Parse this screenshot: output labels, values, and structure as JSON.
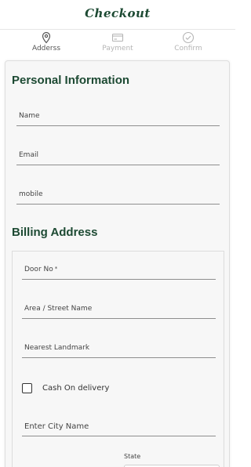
{
  "header": {
    "title": "Checkout"
  },
  "steps": [
    {
      "label": "Adderss",
      "icon": "location-pin-icon",
      "active": true
    },
    {
      "label": "Payment",
      "icon": "credit-card-icon",
      "active": false
    },
    {
      "label": "Confirm",
      "icon": "check-circle-icon",
      "active": false
    }
  ],
  "personal": {
    "title": "Personal Information",
    "fields": {
      "name": "Name",
      "email": "Email",
      "mobile": "mobile"
    }
  },
  "billing": {
    "title": "Billing Address",
    "fields": {
      "door": "Door No",
      "door_required": "*",
      "street": "Area / Street Name",
      "landmark": "Nearest Landmark",
      "city": "Enter City Name",
      "state": "State"
    },
    "cod_label": "Cash On delivery"
  },
  "colors": {
    "brand": "#1d4a33",
    "inactive": "#b5b5b5"
  }
}
